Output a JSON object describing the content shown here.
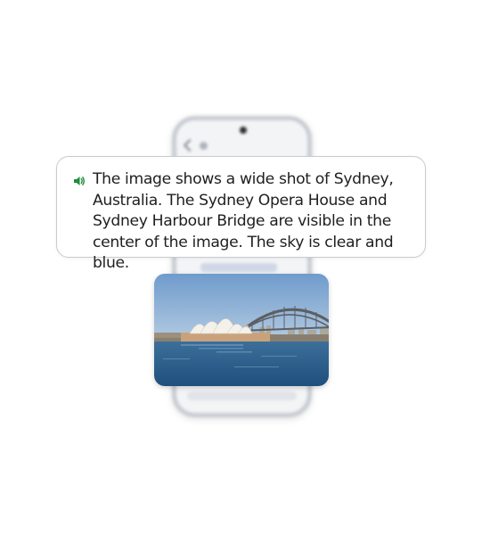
{
  "caption": {
    "icon": "speaker-icon",
    "text": "The image shows a wide shot of Sydney, Australia. The Sydney Opera House and Sydney Harbour Bridge are visible in the center of the image. The sky is clear and blue."
  },
  "photo": {
    "subject": "sydney-harbour-photo"
  },
  "colors": {
    "speaker_icon": "#1e8e3e",
    "sky": "#7fa8d3",
    "water": "#2a5f8e"
  }
}
